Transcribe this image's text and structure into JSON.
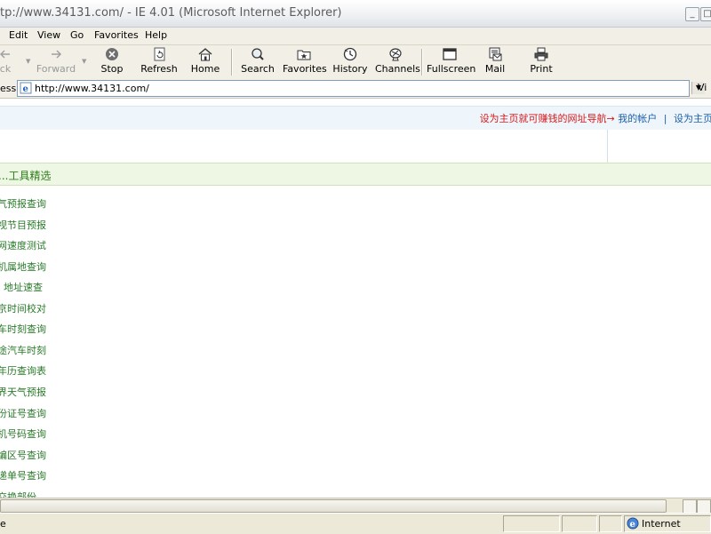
{
  "window": {
    "title": "tp://www.34131.com/ - IE 4.01 (Microsoft Internet Explorer)"
  },
  "menu": {
    "items": [
      "Edit",
      "View",
      "Go",
      "Favorites",
      "Help"
    ]
  },
  "toolbar": {
    "back_label": "ck",
    "forward_label": "Forward",
    "stop_label": "Stop",
    "refresh_label": "Refresh",
    "home_label": "Home",
    "search_label": "Search",
    "favorites_label": "Favorites",
    "history_label": "History",
    "channels_label": "Channels",
    "fullscreen_label": "Fullscreen",
    "mail_label": "Mail",
    "print_label": "Print"
  },
  "address": {
    "label": "ess",
    "value": "http://www.34131.com/",
    "go_label": "Vi"
  },
  "page": {
    "top_links": {
      "set_homepage_earn": "设为主页就可赚钱的网址导航→",
      "my_account": "我的帐户",
      "divider": "|",
      "set_homepage": "设为主页"
    },
    "section_title": "...工具精选",
    "tools": [
      "气预报查询",
      "视节目预报",
      "网速度测试",
      "机属地查询",
      "地址速查",
      "京时间校对",
      "车时刻查询",
      "途汽车时刻",
      "年历查询表",
      "界天气预报",
      "份证号查询",
      "机号码查询",
      "编区号查询",
      "递单号查询",
      "交换部份"
    ]
  },
  "status": {
    "text": "e",
    "zone": "Internet"
  },
  "colors": {
    "accent_red": "#d41c1c",
    "link_blue": "#1f5fa8",
    "tool_green": "#2a7a2a",
    "section_bg": "#eef7e4"
  }
}
